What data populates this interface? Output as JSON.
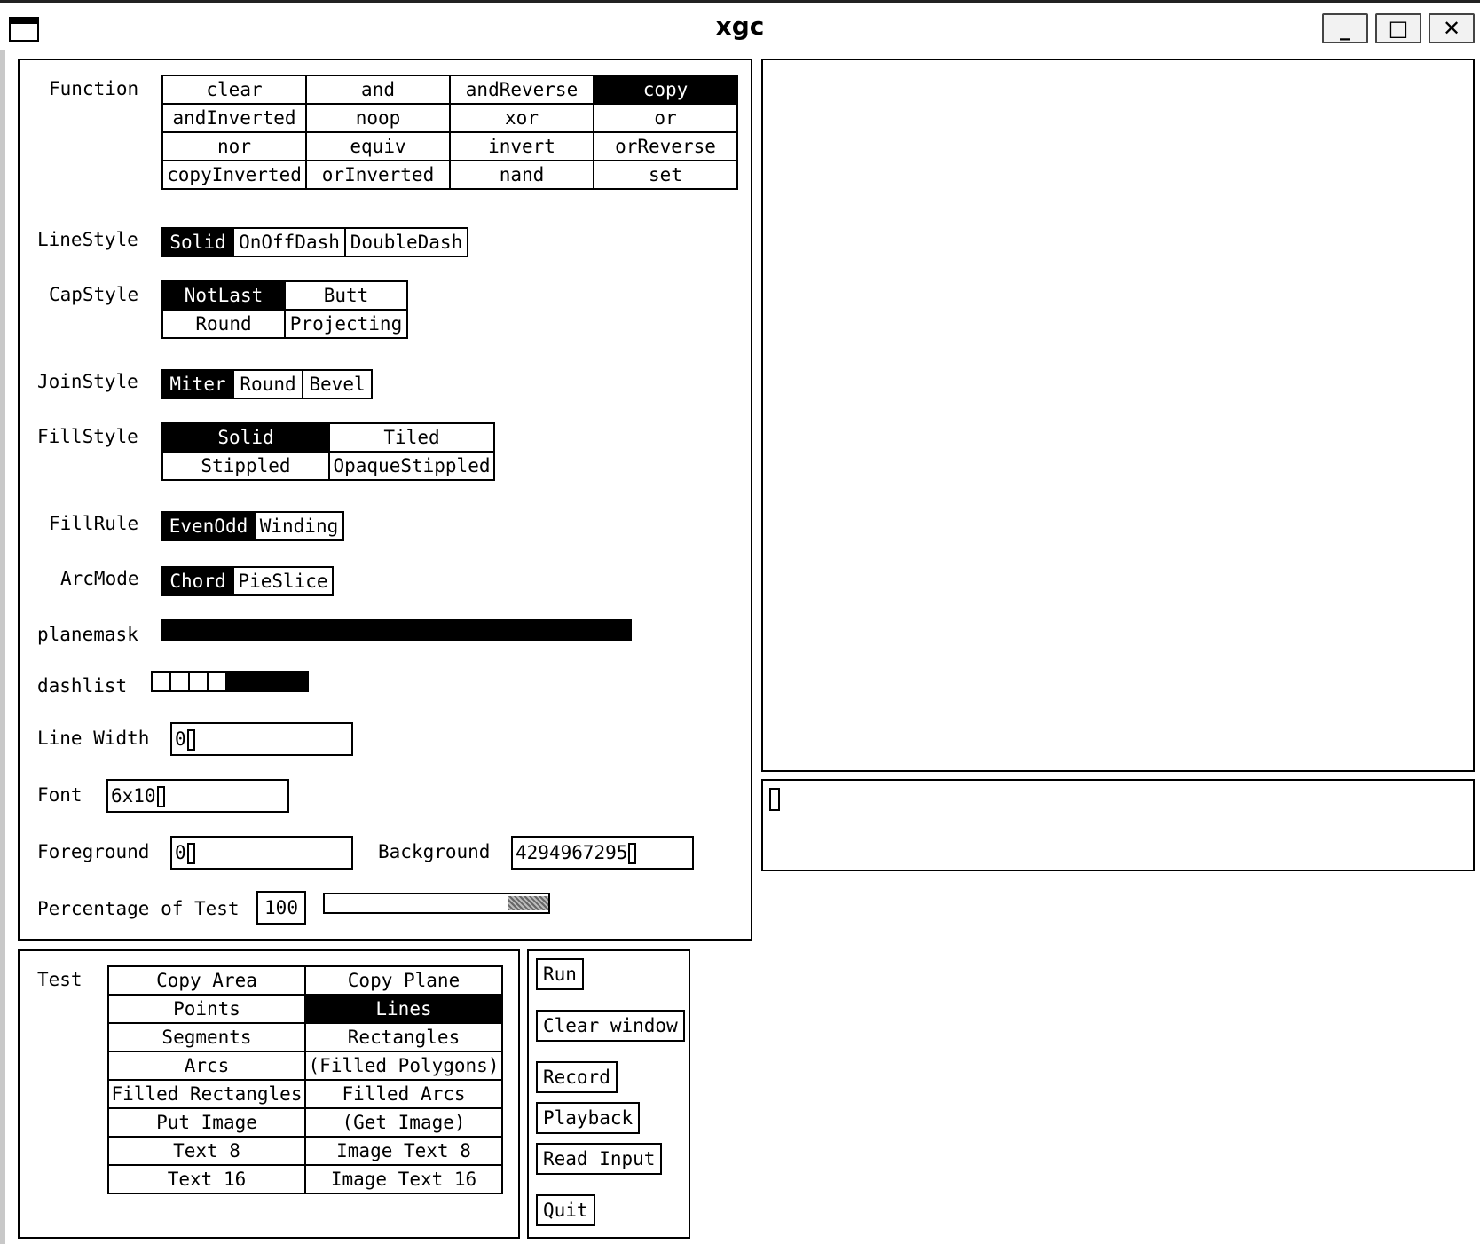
{
  "window": {
    "title": "xgc",
    "minimize": "_",
    "maximize": "□",
    "close": "✕"
  },
  "function": {
    "label": "Function",
    "rows": [
      [
        "clear",
        "and",
        "andReverse",
        "copy"
      ],
      [
        "andInverted",
        "noop",
        "xor",
        "or"
      ],
      [
        "nor",
        "equiv",
        "invert",
        "orReverse"
      ],
      [
        "copyInverted",
        "orInverted",
        "nand",
        "set"
      ]
    ],
    "selected": "copy"
  },
  "linestyle": {
    "label": "LineStyle",
    "options": [
      "Solid",
      "OnOffDash",
      "DoubleDash"
    ],
    "selected": "Solid"
  },
  "capstyle": {
    "label": "CapStyle",
    "options": [
      "NotLast",
      "Butt",
      "Round",
      "Projecting"
    ],
    "selected": "NotLast"
  },
  "joinstyle": {
    "label": "JoinStyle",
    "options": [
      "Miter",
      "Round",
      "Bevel"
    ],
    "selected": "Miter"
  },
  "fillstyle": {
    "label": "FillStyle",
    "options": [
      "Solid",
      "Tiled",
      "Stippled",
      "OpaqueStippled"
    ],
    "selected": "Solid"
  },
  "fillrule": {
    "label": "FillRule",
    "options": [
      "EvenOdd",
      "Winding"
    ],
    "selected": "EvenOdd"
  },
  "arcmode": {
    "label": "ArcMode",
    "options": [
      "Chord",
      "PieSlice"
    ],
    "selected": "Chord"
  },
  "planemask": {
    "label": "planemask"
  },
  "dashlist": {
    "label": "dashlist"
  },
  "linewidth": {
    "label": "Line Width",
    "value": "0"
  },
  "font": {
    "label": "Font",
    "value": "6x10"
  },
  "foreground": {
    "label": "Foreground",
    "value": "0"
  },
  "background": {
    "label": "Background",
    "value": "4294967295"
  },
  "percentage": {
    "label": "Percentage of Test",
    "value": "100",
    "level": 1.0
  },
  "test": {
    "label": "Test",
    "rows": [
      [
        "Copy Area",
        "Copy Plane"
      ],
      [
        "Points",
        "Lines"
      ],
      [
        "Segments",
        "Rectangles"
      ],
      [
        "Arcs",
        "(Filled Polygons)"
      ],
      [
        "Filled Rectangles",
        "Filled Arcs"
      ],
      [
        "Put Image",
        "(Get Image)"
      ],
      [
        "Text 8",
        "Image Text 8"
      ],
      [
        "Text 16",
        "Image Text 16"
      ]
    ],
    "selected": "Lines"
  },
  "commands": {
    "run": "Run",
    "clear": "Clear window",
    "record": "Record",
    "playback": "Playback",
    "read": "Read Input",
    "quit": "Quit"
  }
}
